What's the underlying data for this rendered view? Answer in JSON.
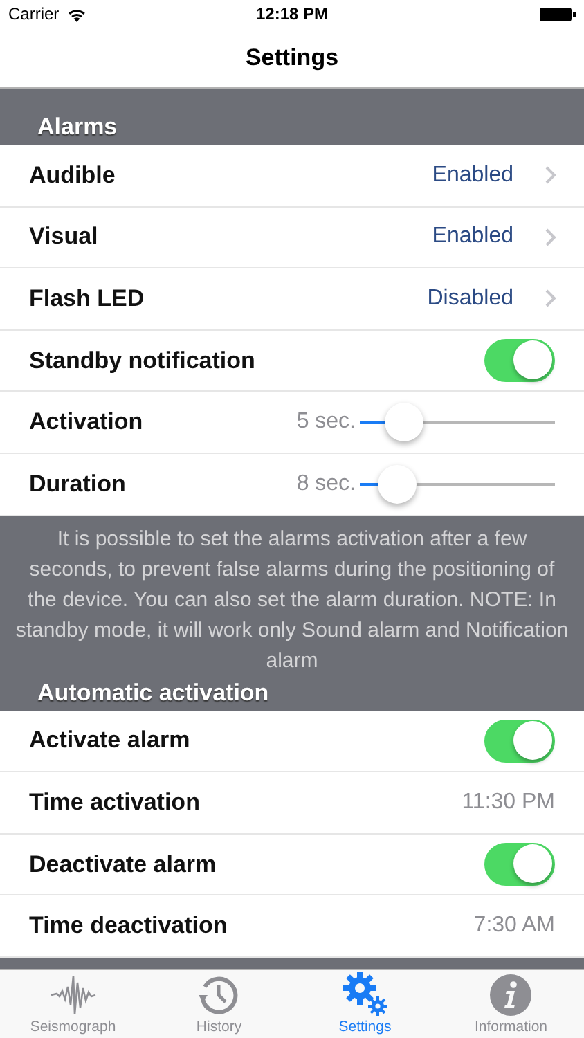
{
  "status_bar": {
    "carrier": "Carrier",
    "time": "12:18 PM"
  },
  "nav": {
    "title": "Settings"
  },
  "sections": [
    {
      "title": "Alarms",
      "rows": [
        {
          "kind": "disclosure",
          "label": "Audible",
          "value": "Enabled"
        },
        {
          "kind": "disclosure",
          "label": "Visual",
          "value": "Enabled"
        },
        {
          "kind": "disclosure",
          "label": "Flash LED",
          "value": "Disabled"
        },
        {
          "kind": "toggle",
          "label": "Standby notification",
          "on": true
        },
        {
          "kind": "slider",
          "label": "Activation",
          "reading": "5 sec.",
          "level": 0.23
        },
        {
          "kind": "slider",
          "label": "Duration",
          "reading": "8 sec.",
          "level": 0.19
        }
      ],
      "footer": "It is possible to set the alarms activation after a few seconds, to prevent false alarms during the positioning of the device. You can also set the alarm duration. NOTE: In standby mode, it will work only Sound alarm and Notification alarm"
    },
    {
      "title": "Automatic activation",
      "rows": [
        {
          "kind": "toggle",
          "label": "Activate alarm",
          "on": true
        },
        {
          "kind": "time",
          "label": "Time activation",
          "value": "11:30 PM"
        },
        {
          "kind": "toggle",
          "label": "Deactivate alarm",
          "on": true
        },
        {
          "kind": "time",
          "label": "Time deactivation",
          "value": "7:30 AM"
        }
      ]
    }
  ],
  "tab_bar": [
    {
      "kind": "seismograph",
      "label": "Seismograph",
      "selected": false
    },
    {
      "kind": "history",
      "label": "History",
      "selected": false
    },
    {
      "kind": "settings",
      "label": "Settings",
      "selected": true
    },
    {
      "kind": "information",
      "label": "Information",
      "selected": false
    }
  ]
}
